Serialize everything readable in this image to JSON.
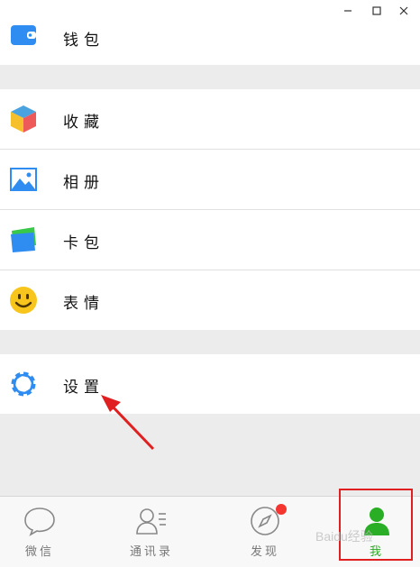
{
  "window": {
    "minimize_icon": "minimize-icon",
    "maximize_icon": "maximize-icon",
    "close_icon": "close-icon"
  },
  "menu": {
    "wallet_label": "钱包",
    "favorites_label": "收藏",
    "album_label": "相册",
    "cards_label": "卡包",
    "stickers_label": "表情",
    "settings_label": "设置"
  },
  "tabbar": {
    "tabs": [
      {
        "label": "微信",
        "icon": "chat-bubble-icon"
      },
      {
        "label": "通讯录",
        "icon": "contacts-icon"
      },
      {
        "label": "发现",
        "icon": "compass-icon"
      },
      {
        "label": "我",
        "icon": "person-icon"
      }
    ],
    "active_tab": "我"
  },
  "watermark": "Baidu经验",
  "colors": {
    "accent_green": "#2aae25",
    "badge_red": "#f43530",
    "annotation_red": "#e02020",
    "background": "#ececec"
  }
}
